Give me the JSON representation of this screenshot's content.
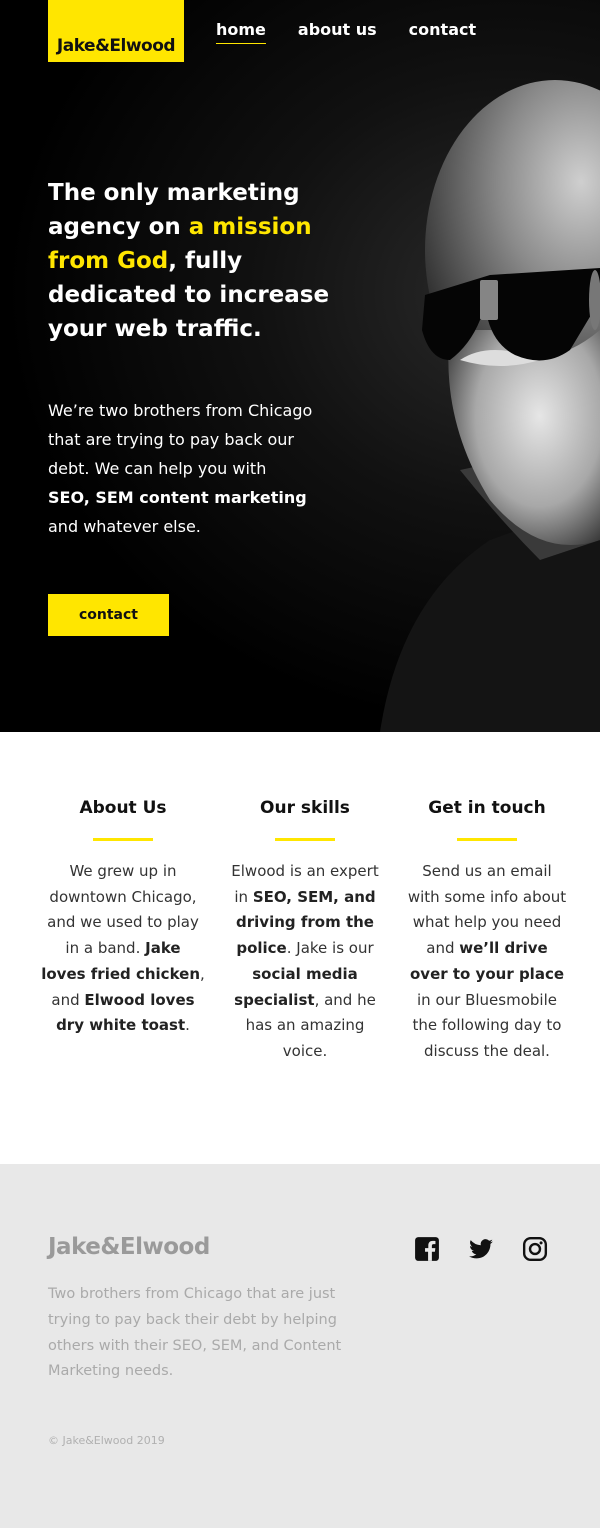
{
  "brand": {
    "logo_text": "Jake&Elwood",
    "accent_color": "#ffe600"
  },
  "nav": {
    "items": [
      {
        "label": "home",
        "active": true
      },
      {
        "label": "about us",
        "active": false
      },
      {
        "label": "contact",
        "active": false
      }
    ]
  },
  "hero": {
    "headline_part1": "The only marketing agency on ",
    "headline_highlight": "a mission from God",
    "headline_part2": ", fully dedicated to increase your web traffic.",
    "intro_part1": "We’re two brothers from Chicago that are trying to pay back our debt. We can help you with ",
    "intro_bold": "SEO, SEM content marketing",
    "intro_part2": " and whatever else.",
    "cta_label": "contact"
  },
  "features": {
    "about": {
      "title": "About Us",
      "t1": "We grew up in downtown Chicago, and we used to play in a band. ",
      "b1": "Jake loves fried chicken",
      "t2": ", and ",
      "b2": "Elwood loves dry white toast",
      "t3": "."
    },
    "skills": {
      "title": "Our skills",
      "t1": "Elwood is an expert in ",
      "b1": "SEO, SEM, and driving from the police",
      "t2": ". Jake is our ",
      "b2": "social media specialist",
      "t3": ", and he has an amazing voice."
    },
    "touch": {
      "title": "Get in touch",
      "t1": "Send us an email with some info about what help you need and ",
      "b1": "we’ll drive over to your place",
      "t2": " in our Bluesmobile the following day to discuss the deal."
    }
  },
  "footer": {
    "logo_text": "Jake&Elwood",
    "description": "Two brothers from Chicago that are just trying to pay back their debt by helping others with their SEO, SEM, and Content Marketing needs.",
    "copyright": "© Jake&Elwood 2019",
    "social_icons": [
      "facebook-icon",
      "twitter-icon",
      "instagram-icon"
    ]
  }
}
